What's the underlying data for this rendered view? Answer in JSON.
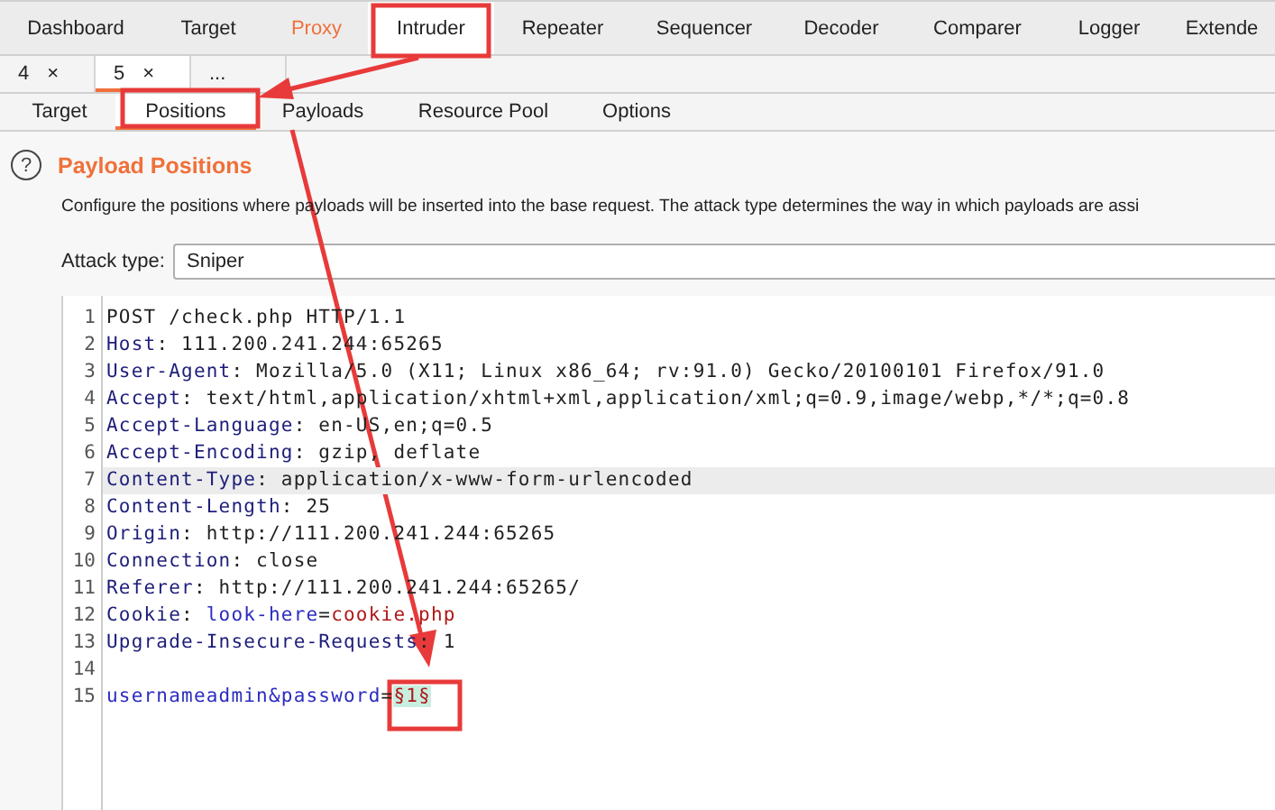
{
  "main_tabs": [
    {
      "label": "Dashboard",
      "selected": false,
      "highlighted": false
    },
    {
      "label": "Target",
      "selected": false,
      "highlighted": false
    },
    {
      "label": "Proxy",
      "selected": false,
      "highlighted": true
    },
    {
      "label": "Intruder",
      "selected": true,
      "highlighted": false
    },
    {
      "label": "Repeater",
      "selected": false,
      "highlighted": false
    },
    {
      "label": "Sequencer",
      "selected": false,
      "highlighted": false
    },
    {
      "label": "Decoder",
      "selected": false,
      "highlighted": false
    },
    {
      "label": "Comparer",
      "selected": false,
      "highlighted": false
    },
    {
      "label": "Logger",
      "selected": false,
      "highlighted": false
    },
    {
      "label": "Extende",
      "selected": false,
      "highlighted": false
    }
  ],
  "attack_tabs": [
    {
      "label": "4",
      "close": "×",
      "selected": false
    },
    {
      "label": "5",
      "close": "×",
      "selected": true
    },
    {
      "label": "...",
      "selected": false
    }
  ],
  "sub_tabs": [
    {
      "label": "Target",
      "selected": false
    },
    {
      "label": "Positions",
      "selected": true
    },
    {
      "label": "Payloads",
      "selected": false
    },
    {
      "label": "Resource Pool",
      "selected": false
    },
    {
      "label": "Options",
      "selected": false
    }
  ],
  "panel": {
    "help": "?",
    "title": "Payload Positions",
    "description": "Configure the positions where payloads will be inserted into the base request. The attack type determines the way in which payloads are assi",
    "attack_type_label": "Attack type:",
    "attack_type": "Sniper"
  },
  "request": {
    "lines": [
      {
        "number": "1",
        "highlighted": false,
        "segments": [
          {
            "kind": "plain",
            "text": "POST /check.php HTTP/1.1"
          }
        ]
      },
      {
        "number": "2",
        "highlighted": false,
        "segments": [
          {
            "kind": "key",
            "text": "Host"
          },
          {
            "kind": "plain",
            "text": ": 111.200.241.244:65265"
          }
        ]
      },
      {
        "number": "3",
        "highlighted": false,
        "segments": [
          {
            "kind": "key",
            "text": "User-Agent"
          },
          {
            "kind": "plain",
            "text": ": Mozilla/5.0 (X11; Linux x86_64; rv:91.0) Gecko/20100101 Firefox/91.0"
          }
        ]
      },
      {
        "number": "4",
        "highlighted": false,
        "segments": [
          {
            "kind": "key",
            "text": "Accept"
          },
          {
            "kind": "plain",
            "text": ": text/html,application/xhtml+xml,application/xml;q=0.9,image/webp,*/*;q=0.8"
          }
        ]
      },
      {
        "number": "5",
        "highlighted": false,
        "segments": [
          {
            "kind": "key",
            "text": "Accept-Language"
          },
          {
            "kind": "plain",
            "text": ": en-US,en;q=0.5"
          }
        ]
      },
      {
        "number": "6",
        "highlighted": false,
        "segments": [
          {
            "kind": "key",
            "text": "Accept-Encoding"
          },
          {
            "kind": "plain",
            "text": ": gzip, deflate"
          }
        ]
      },
      {
        "number": "7",
        "highlighted": true,
        "segments": [
          {
            "kind": "key",
            "text": "Content-Type"
          },
          {
            "kind": "plain",
            "text": ": application/x-www-form-urlencoded"
          }
        ]
      },
      {
        "number": "8",
        "highlighted": false,
        "segments": [
          {
            "kind": "key",
            "text": "Content-Length"
          },
          {
            "kind": "plain",
            "text": ": 25"
          }
        ]
      },
      {
        "number": "9",
        "highlighted": false,
        "segments": [
          {
            "kind": "key",
            "text": "Origin"
          },
          {
            "kind": "plain",
            "text": ": http://111.200.241.244:65265"
          }
        ]
      },
      {
        "number": "10",
        "highlighted": false,
        "segments": [
          {
            "kind": "key",
            "text": "Connection"
          },
          {
            "kind": "plain",
            "text": ": close"
          }
        ]
      },
      {
        "number": "11",
        "highlighted": false,
        "segments": [
          {
            "kind": "key",
            "text": "Referer"
          },
          {
            "kind": "plain",
            "text": ": http://111.200.241.244:65265/"
          }
        ]
      },
      {
        "number": "12",
        "highlighted": false,
        "segments": [
          {
            "kind": "key",
            "text": "Cookie"
          },
          {
            "kind": "plain",
            "text": ": "
          },
          {
            "kind": "param",
            "text": "look-here"
          },
          {
            "kind": "plain",
            "text": "="
          },
          {
            "kind": "value",
            "text": "cookie.php"
          }
        ]
      },
      {
        "number": "13",
        "highlighted": false,
        "segments": [
          {
            "kind": "key",
            "text": "Upgrade-Insecure-Requests"
          },
          {
            "kind": "plain",
            "text": ": 1"
          }
        ]
      },
      {
        "number": "14"
      },
      {
        "number": "15",
        "highlighted": false,
        "segments": [
          {
            "kind": "param",
            "text": "usernameadmin&password"
          },
          {
            "kind": "plain",
            "text": "="
          },
          {
            "kind": "marker",
            "text": "§1§"
          }
        ]
      }
    ]
  }
}
